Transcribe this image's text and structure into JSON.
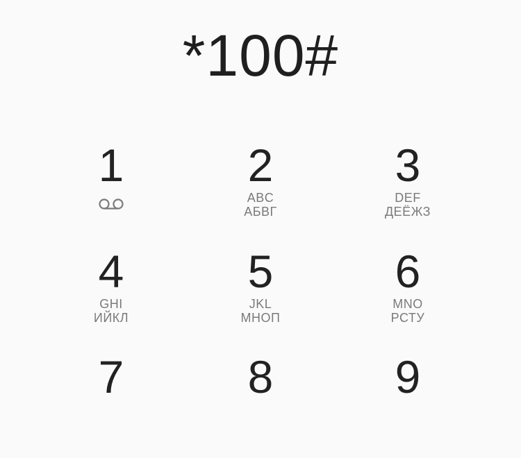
{
  "dialer": {
    "number": "*100#"
  },
  "keys": [
    {
      "digit": "1",
      "latin": "",
      "cyrillic": "",
      "icon": "voicemail-icon"
    },
    {
      "digit": "2",
      "latin": "ABC",
      "cyrillic": "АБВГ"
    },
    {
      "digit": "3",
      "latin": "DEF",
      "cyrillic": "ДЕЁЖЗ"
    },
    {
      "digit": "4",
      "latin": "GHI",
      "cyrillic": "ИЙКЛ"
    },
    {
      "digit": "5",
      "latin": "JKL",
      "cyrillic": "МНОП"
    },
    {
      "digit": "6",
      "latin": "MNO",
      "cyrillic": "РСТУ"
    },
    {
      "digit": "7",
      "latin": "",
      "cyrillic": ""
    },
    {
      "digit": "8",
      "latin": "",
      "cyrillic": ""
    },
    {
      "digit": "9",
      "latin": "",
      "cyrillic": ""
    }
  ]
}
